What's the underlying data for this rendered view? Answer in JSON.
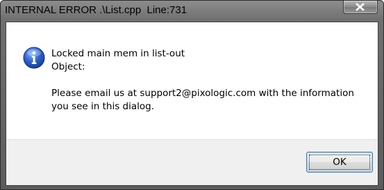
{
  "window": {
    "title": "INTERNAL ERROR .\\List.cpp  Line:731"
  },
  "icons": {
    "close": "close-icon",
    "info": "info-icon"
  },
  "message": {
    "line1": "Locked main mem in list-out",
    "line2": "Object:",
    "line3": "Please email us at support2@pixologic.com with the information",
    "line4": "you see in this dialog."
  },
  "buttons": {
    "ok_label": "OK"
  },
  "colors": {
    "info_blue": "#2b5fc9",
    "footer_bg": "#f0f0f0",
    "focus_border": "#3c7fb1"
  }
}
